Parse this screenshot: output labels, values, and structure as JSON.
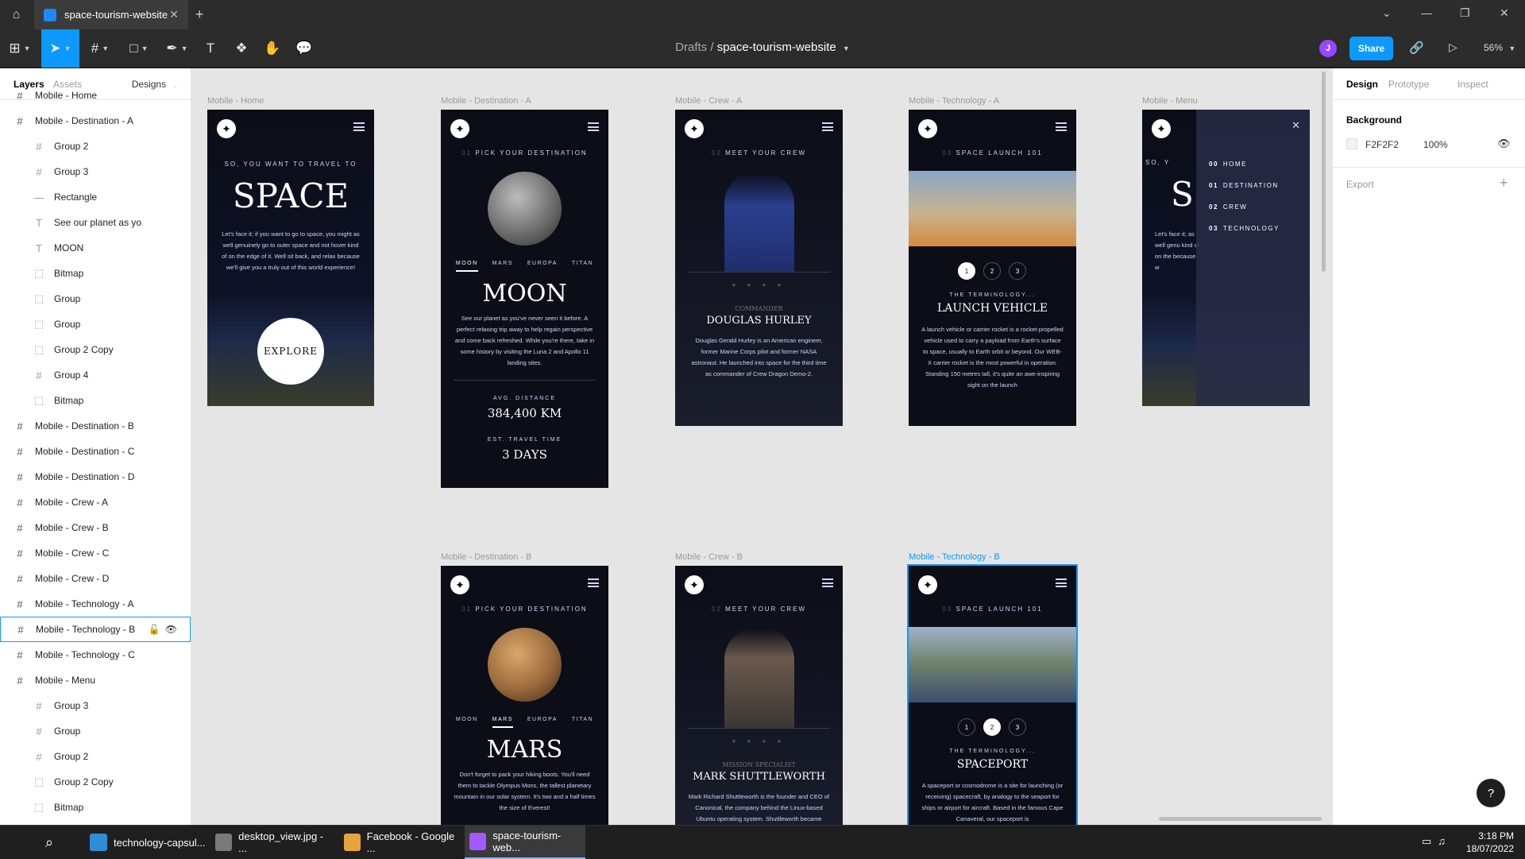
{
  "window": {
    "tab_title": "space-tourism-website",
    "home_icon": "house-icon",
    "new_tab": "+"
  },
  "toolbar": {
    "breadcrumb_drafts": "Drafts",
    "breadcrumb_sep": "/",
    "project": "space-tourism-website",
    "avatar_initial": "J",
    "share_label": "Share",
    "zoom": "56%"
  },
  "left_panel": {
    "tabs": {
      "layers": "Layers",
      "assets": "Assets",
      "pages": "Designs"
    },
    "layers": [
      {
        "label": "Mobile - Home",
        "type": "frame",
        "indent": 0
      },
      {
        "label": "Mobile - Destination - A",
        "type": "frame",
        "indent": 0
      },
      {
        "label": "Group 2",
        "type": "group",
        "indent": 1
      },
      {
        "label": "Group 3",
        "type": "group",
        "indent": 1
      },
      {
        "label": "Rectangle",
        "type": "rect",
        "indent": 1
      },
      {
        "label": "See our planet as yo",
        "type": "text",
        "indent": 1
      },
      {
        "label": "MOON",
        "type": "text",
        "indent": 1
      },
      {
        "label": "Bitmap",
        "type": "image",
        "indent": 1
      },
      {
        "label": "Group",
        "type": "image",
        "indent": 1
      },
      {
        "label": "Group",
        "type": "image",
        "indent": 1
      },
      {
        "label": "Group 2 Copy",
        "type": "image",
        "indent": 1
      },
      {
        "label": "Group 4",
        "type": "group",
        "indent": 1
      },
      {
        "label": "Bitmap",
        "type": "image",
        "indent": 1
      },
      {
        "label": "Mobile - Destination - B",
        "type": "frame",
        "indent": 0
      },
      {
        "label": "Mobile - Destination - C",
        "type": "frame",
        "indent": 0
      },
      {
        "label": "Mobile - Destination - D",
        "type": "frame",
        "indent": 0
      },
      {
        "label": "Mobile - Crew - A",
        "type": "frame",
        "indent": 0
      },
      {
        "label": "Mobile - Crew - B",
        "type": "frame",
        "indent": 0
      },
      {
        "label": "Mobile - Crew - C",
        "type": "frame",
        "indent": 0
      },
      {
        "label": "Mobile - Crew - D",
        "type": "frame",
        "indent": 0
      },
      {
        "label": "Mobile - Technology - A",
        "type": "frame",
        "indent": 0
      },
      {
        "label": "Mobile - Technology - B",
        "type": "frame",
        "indent": 0,
        "selected": true
      },
      {
        "label": "Mobile - Technology - C",
        "type": "frame",
        "indent": 0
      },
      {
        "label": "Mobile - Menu",
        "type": "frame",
        "indent": 0
      },
      {
        "label": "Group 3",
        "type": "group",
        "indent": 1
      },
      {
        "label": "Group",
        "type": "group",
        "indent": 1
      },
      {
        "label": "Group 2",
        "type": "group",
        "indent": 1
      },
      {
        "label": "Group 2 Copy",
        "type": "image",
        "indent": 1
      },
      {
        "label": "Bitmap",
        "type": "image",
        "indent": 1
      }
    ]
  },
  "canvas": {
    "background": "#E5E5E5",
    "frames": {
      "home": {
        "label": "Mobile - Home",
        "subtitle": "SO, YOU WANT TO TRAVEL TO",
        "title": "SPACE",
        "body": "Let's face it; if you want to go to space, you might as well genuinely go to outer space and not hover kind of on the edge of it. Well sit back, and relax because we'll give you a truly out of this world experience!",
        "button": "EXPLORE"
      },
      "dest_a": {
        "label": "Mobile - Destination - A",
        "num": "01",
        "subtitle": "PICK YOUR DESTINATION",
        "tabs": [
          "MOON",
          "MARS",
          "EUROPA",
          "TITAN"
        ],
        "active_tab": 0,
        "title": "MOON",
        "body": "See our planet as you've never seen it before. A perfect relaxing trip away to help regain perspective and come back refreshed. While you're there, take in some history by visiting the Luna 2 and Apollo 11 landing sites.",
        "dist_label": "AVG. DISTANCE",
        "dist_value": "384,400 KM",
        "time_label": "EST. TRAVEL TIME",
        "time_value": "3 DAYS"
      },
      "crew_a": {
        "label": "Mobile - Crew - A",
        "num": "02",
        "subtitle": "MEET YOUR CREW",
        "role": "COMMANDER",
        "name": "DOUGLAS HURLEY",
        "body": "Douglas Gerald Hurley is an American engineer, former Marine Corps pilot and former NASA astronaut. He launched into space for the third time as commander of Crew Dragon Demo-2.",
        "dots": "● ● ● ●"
      },
      "tech_a": {
        "label": "Mobile - Technology - A",
        "num": "03",
        "subtitle": "SPACE LAUNCH 101",
        "buttons": [
          "1",
          "2",
          "3"
        ],
        "active": 0,
        "kicker": "THE TERMINOLOGY...",
        "title": "LAUNCH VEHICLE",
        "body": "A launch vehicle or carrier rocket is a rocket-propelled vehicle used to carry a payload from Earth's surface to space, usually to Earth orbit or beyond. Our WEB-X carrier rocket is the most powerful in operation. Standing 150 metres tall, it's quite an awe-inspiring sight on the launch"
      },
      "menu": {
        "label": "Mobile - Menu",
        "items": [
          {
            "num": "00",
            "text": "HOME"
          },
          {
            "num": "01",
            "text": "DESTINATION"
          },
          {
            "num": "02",
            "text": "CREW"
          },
          {
            "num": "03",
            "text": "TECHNOLOGY"
          }
        ],
        "peek_sub": "SO, Y",
        "peek_title": "S",
        "peek_body": "Let's face it; as well genu kind of on the because w"
      },
      "dest_b": {
        "label": "Mobile - Destination - B",
        "num": "01",
        "subtitle": "PICK YOUR DESTINATION",
        "tabs": [
          "MOON",
          "MARS",
          "EUROPA",
          "TITAN"
        ],
        "active_tab": 1,
        "title": "MARS",
        "body": "Don't forget to pack your hiking boots. You'll need them to tackle Olympus Mons, the tallest planetary mountain in our solar system. It's two and a half times the size of Everest!"
      },
      "crew_b": {
        "label": "Mobile - Crew - B",
        "num": "02",
        "subtitle": "MEET YOUR CREW",
        "role": "MISSION SPECIALIST",
        "name": "MARK SHUTTLEWORTH",
        "body": "Mark Richard Shuttleworth is the founder and CEO of Canonical, the company behind the Linux-based Ubuntu operating system. Shuttleworth became",
        "dots": "● ● ● ●"
      },
      "tech_b": {
        "label": "Mobile - Technology - B",
        "num": "03",
        "subtitle": "SPACE LAUNCH 101",
        "buttons": [
          "1",
          "2",
          "3"
        ],
        "active": 1,
        "kicker": "THE TERMINOLOGY...",
        "title": "SPACEPORT",
        "body": "A spaceport or cosmodrome is a site for launching (or receiving) spacecraft, by analogy to the seaport for ships or airport for aircraft. Based in the famous Cape Canaveral, our spaceport is"
      }
    }
  },
  "right_panel": {
    "tabs": [
      "Design",
      "Prototype",
      "Inspect"
    ],
    "background_title": "Background",
    "bg_hex": "F2F2F2",
    "bg_opacity": "100%",
    "export_title": "Export"
  },
  "taskbar": {
    "apps": [
      {
        "label": "technology-capsul...",
        "color": "#2f8dd8"
      },
      {
        "label": "desktop_view.jpg - ...",
        "color": "#7a7a7a"
      },
      {
        "label": "Facebook - Google ...",
        "color": "#e8a33d"
      },
      {
        "label": "space-tourism-web...",
        "color": "#a259ff"
      }
    ],
    "time": "3:18 PM",
    "date": "18/07/2022"
  },
  "help": "?"
}
